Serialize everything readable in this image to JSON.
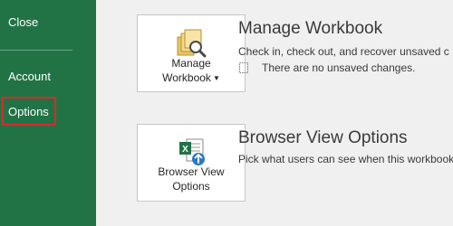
{
  "sidebar": {
    "close_label": "Close",
    "account_label": "Account",
    "options_label": "Options",
    "background_color": "#217346",
    "highlight_color": "#e0262a"
  },
  "manage_workbook": {
    "tile_label_line1": "Manage",
    "tile_label_line2": "Workbook",
    "title": "Manage Workbook",
    "description": "Check in, check out, and recover unsaved c",
    "status": "There are no unsaved changes.",
    "icon": "folder-search-icon"
  },
  "browser_view": {
    "tile_label_line1": "Browser View",
    "tile_label_line2": "Options",
    "title": "Browser View Options",
    "description": "Pick what users can see when this workbook",
    "icon": "excel-web-icon"
  }
}
